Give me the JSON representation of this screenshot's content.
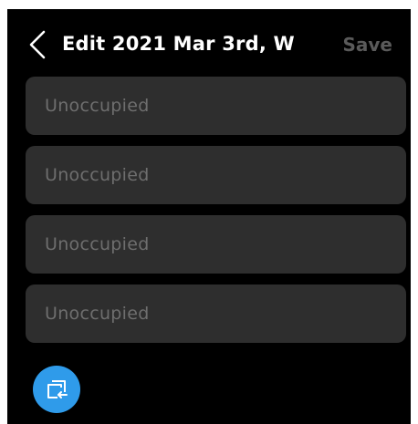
{
  "header": {
    "title": "Edit 2021 Mar 3rd, W",
    "save_label": "Save",
    "back_icon": "chevron-left-icon"
  },
  "periods": [
    {
      "label": "Unoccupied"
    },
    {
      "label": "Unoccupied"
    },
    {
      "label": "Unoccupied"
    },
    {
      "label": "Unoccupied"
    }
  ],
  "copy_button": {
    "icon": "copy-schedule-icon"
  },
  "colors": {
    "background": "#000000",
    "field": "#2e2e2e",
    "placeholder_text": "#6e6e6e",
    "disabled_save": "#5a5a5a",
    "accent": "#2f9bea"
  }
}
